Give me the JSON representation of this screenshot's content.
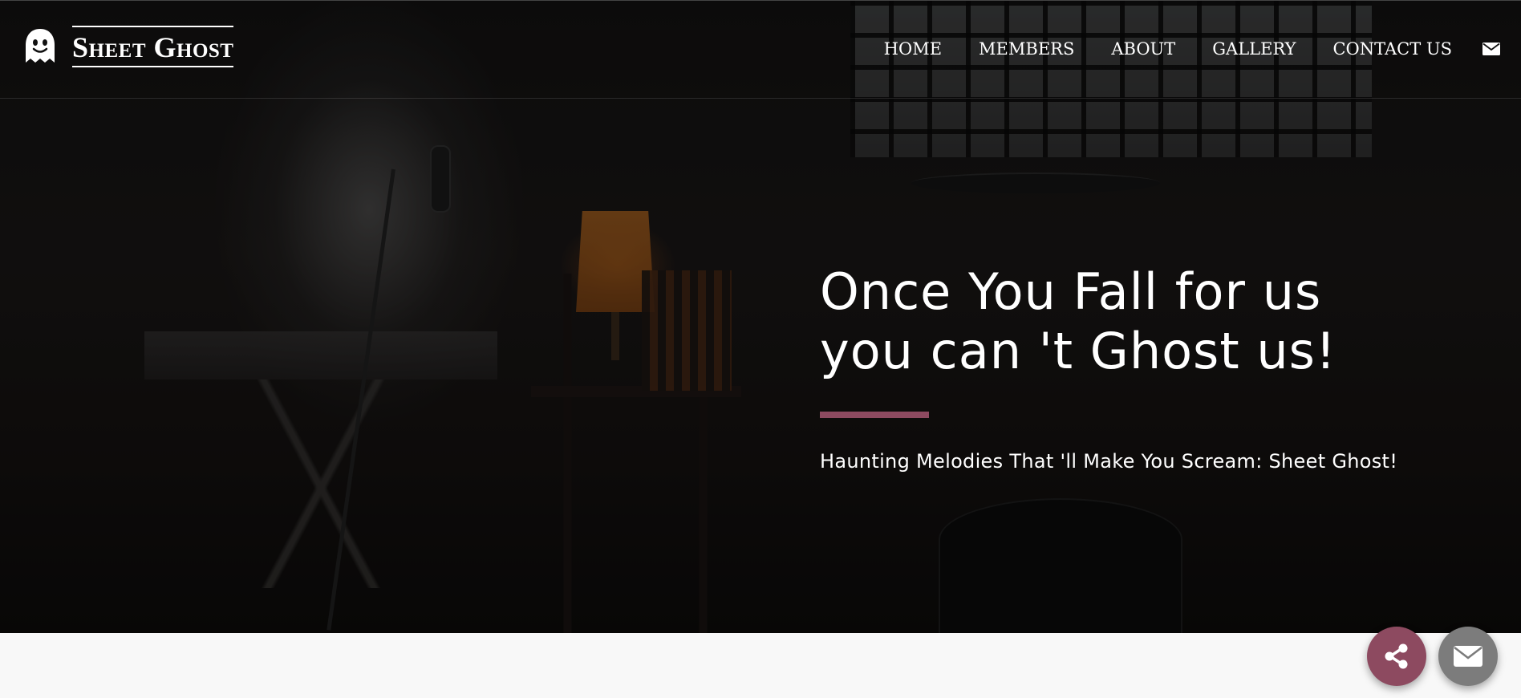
{
  "brand": {
    "name": "Sheet Ghost",
    "logo_icon": "ghost-icon"
  },
  "nav": {
    "items": [
      {
        "label": "HOME"
      },
      {
        "label": "MEMBERS"
      },
      {
        "label": "ABOUT"
      },
      {
        "label": "GALLERY"
      },
      {
        "label": "CONTACT US"
      }
    ],
    "mail_icon": "envelope-icon"
  },
  "hero": {
    "title_line1": "Once You Fall for us",
    "title_line2": "you can 't Ghost us!",
    "subtitle": "Haunting Melodies That 'll Make You Scream: Sheet Ghost!",
    "accent_color": "#8d4a60"
  },
  "floating_buttons": {
    "share_icon": "share-icon",
    "share_color": "#8d4a60",
    "mail_icon": "envelope-icon",
    "mail_color": "#7c7c7c"
  }
}
